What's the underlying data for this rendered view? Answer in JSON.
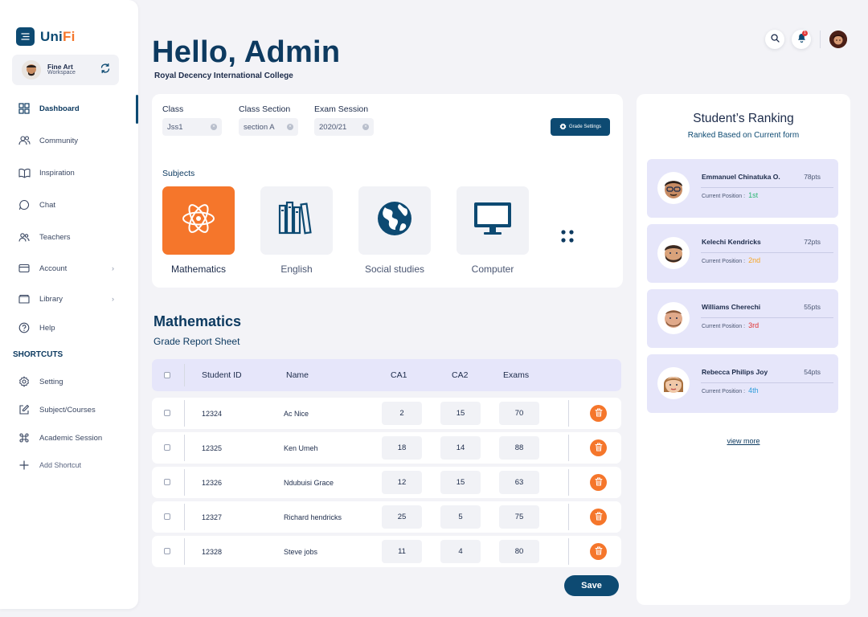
{
  "brand": {
    "name_main": "Uni",
    "name_accent": "Fi"
  },
  "workspace": {
    "name": "Fine Art",
    "sub": "Workspace"
  },
  "nav": [
    {
      "label": "Dashboard",
      "icon": "grid-icon",
      "active": true
    },
    {
      "label": "Community",
      "icon": "users-icon"
    },
    {
      "label": "Inspiration",
      "icon": "book-open-icon"
    },
    {
      "label": "Chat",
      "icon": "chat-icon"
    },
    {
      "label": "Teachers",
      "icon": "teachers-icon"
    },
    {
      "label": "Account",
      "icon": "card-icon",
      "chevron": true
    },
    {
      "label": "Library",
      "icon": "folder-icon",
      "chevron": true
    },
    {
      "label": "Help",
      "icon": "help-icon"
    }
  ],
  "shortcuts": {
    "title": "SHORTCUTS",
    "items": [
      {
        "label": "Setting",
        "icon": "gear-icon"
      },
      {
        "label": "Subject/Courses",
        "icon": "edit-icon"
      },
      {
        "label": "Academic Session",
        "icon": "command-icon"
      },
      {
        "label": "Add Shortcut",
        "icon": "plus-icon"
      }
    ]
  },
  "header": {
    "greeting": "Hello, Admin",
    "college": "Royal Decency International College",
    "notification_count": "1"
  },
  "filters": {
    "class_label": "Class",
    "class_value": "Jss1",
    "section_label": "Class Section",
    "section_value": "section A",
    "session_label": "Exam Session",
    "session_value": "2020/21",
    "grade_settings": "Grade Settings"
  },
  "subjects": {
    "label": "Subjects",
    "items": [
      "Mathematics",
      "English",
      "Social studies",
      "Computer"
    ]
  },
  "report": {
    "title": "Mathematics",
    "subtitle": "Grade Report Sheet",
    "columns": [
      "Student ID",
      "Name",
      "CA1",
      "CA2",
      "Exams"
    ],
    "rows": [
      {
        "id": "12324",
        "name": "Ac Nice",
        "ca1": "2",
        "ca2": "15",
        "exams": "70"
      },
      {
        "id": "12325",
        "name": "Ken Umeh",
        "ca1": "18",
        "ca2": "14",
        "exams": "88"
      },
      {
        "id": "12326",
        "name": "Ndubuisi Grace",
        "ca1": "12",
        "ca2": "15",
        "exams": "63"
      },
      {
        "id": "12327",
        "name": "Richard hendricks",
        "ca1": "25",
        "ca2": "5",
        "exams": "75"
      },
      {
        "id": "12328",
        "name": "Steve jobs",
        "ca1": "11",
        "ca2": "4",
        "exams": "80"
      }
    ],
    "save_label": "Save"
  },
  "ranking": {
    "title": "Student’s Ranking",
    "subtitle": "Ranked Based on Current form",
    "position_label": "Current Position :",
    "students": [
      {
        "name": "Emmanuel Chinatuka O.",
        "pts": "78pts",
        "position": "1st",
        "color": "#2bb673"
      },
      {
        "name": "Kelechi Kendricks",
        "pts": "72pts",
        "position": "2nd",
        "color": "#f5a524"
      },
      {
        "name": "Williams Cherechi",
        "pts": "55pts",
        "position": "3rd",
        "color": "#e03131"
      },
      {
        "name": "Rebecca Philips Joy",
        "pts": "54pts",
        "position": "4th",
        "color": "#2d9cdb"
      }
    ],
    "view_more": "view more"
  },
  "colors": {
    "primary": "#0d4a72",
    "accent": "#f5762b",
    "lavender": "#e6e6fa"
  }
}
